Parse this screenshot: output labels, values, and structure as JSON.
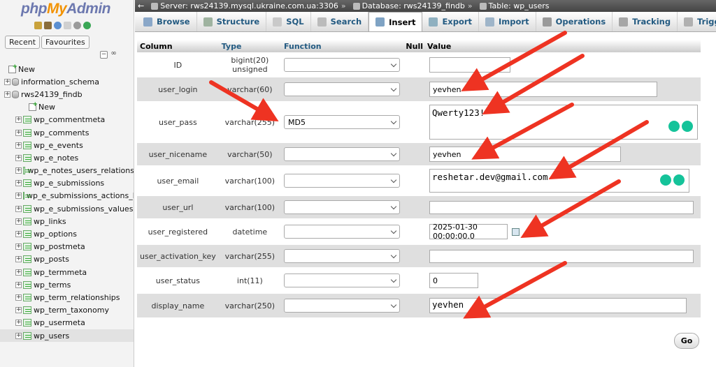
{
  "app": {
    "logo_php": "php",
    "logo_my": "My",
    "logo_admin": "Admin"
  },
  "nav": {
    "recent_label": "Recent",
    "favourites_label": "Favourites",
    "items": [
      {
        "label": "New",
        "kind": "new",
        "indent": 12
      },
      {
        "label": "information_schema",
        "kind": "db",
        "indent": 6
      },
      {
        "label": "rws24139_findb",
        "kind": "db",
        "indent": 6
      },
      {
        "label": "New",
        "kind": "new",
        "indent": 30
      },
      {
        "label": "wp_commentmeta",
        "kind": "table",
        "indent": 22
      },
      {
        "label": "wp_comments",
        "kind": "table",
        "indent": 22
      },
      {
        "label": "wp_e_events",
        "kind": "table",
        "indent": 22
      },
      {
        "label": "wp_e_notes",
        "kind": "table",
        "indent": 22
      },
      {
        "label": "wp_e_notes_users_relations",
        "kind": "table",
        "indent": 22
      },
      {
        "label": "wp_e_submissions",
        "kind": "table",
        "indent": 22
      },
      {
        "label": "wp_e_submissions_actions_lo",
        "kind": "table",
        "indent": 22
      },
      {
        "label": "wp_e_submissions_values",
        "kind": "table",
        "indent": 22
      },
      {
        "label": "wp_links",
        "kind": "table",
        "indent": 22
      },
      {
        "label": "wp_options",
        "kind": "table",
        "indent": 22
      },
      {
        "label": "wp_postmeta",
        "kind": "table",
        "indent": 22
      },
      {
        "label": "wp_posts",
        "kind": "table",
        "indent": 22
      },
      {
        "label": "wp_termmeta",
        "kind": "table",
        "indent": 22
      },
      {
        "label": "wp_terms",
        "kind": "table",
        "indent": 22
      },
      {
        "label": "wp_term_relationships",
        "kind": "table",
        "indent": 22
      },
      {
        "label": "wp_term_taxonomy",
        "kind": "table",
        "indent": 22
      },
      {
        "label": "wp_usermeta",
        "kind": "table",
        "indent": 22
      },
      {
        "label": "wp_users",
        "kind": "table",
        "indent": 22,
        "selected": true
      }
    ]
  },
  "breadcrumb": {
    "server": "Server: rws24139.mysql.ukraine.com.ua:3306",
    "database": "Database: rws24139_findb",
    "table": "Table: wp_users",
    "separator": "»"
  },
  "tabs": [
    {
      "label": "Browse",
      "icon_color": "#8aa7c8"
    },
    {
      "label": "Structure",
      "icon_color": "#9fb3a0"
    },
    {
      "label": "SQL",
      "icon_color": "#c9c9c9"
    },
    {
      "label": "Search",
      "icon_color": "#bbbbbb"
    },
    {
      "label": "Insert",
      "icon_color": "#7fa3c4",
      "active": true
    },
    {
      "label": "Export",
      "icon_color": "#8fb0c0"
    },
    {
      "label": "Import",
      "icon_color": "#9fb5c9"
    },
    {
      "label": "Operations",
      "icon_color": "#9a9a9a"
    },
    {
      "label": "Tracking",
      "icon_color": "#a6a6a6"
    },
    {
      "label": "Triggers",
      "icon_color": "#b0b0b0"
    }
  ],
  "grid": {
    "headers": {
      "column": "Column",
      "type": "Type",
      "function": "Function",
      "null": "Null",
      "value": "Value"
    },
    "rows": [
      {
        "column": "ID",
        "type": "bigint(20) unsigned",
        "function": "",
        "value": "",
        "kind": "input",
        "vw": 116
      },
      {
        "column": "user_login",
        "type": "varchar(60)",
        "function": "",
        "value": "yevhen",
        "kind": "input",
        "vw": 326
      },
      {
        "column": "user_pass",
        "type": "varchar(255)",
        "function": "MD5",
        "value": "Qwerty123!",
        "kind": "textarea",
        "vw": 384
      },
      {
        "column": "user_nicename",
        "type": "varchar(50)",
        "function": "",
        "value": "yevhen",
        "kind": "input",
        "vw": 274
      },
      {
        "column": "user_email",
        "type": "varchar(100)",
        "function": "",
        "value": "reshetar.dev@gmail.com",
        "kind": "textarea",
        "vw": 372
      },
      {
        "column": "user_url",
        "type": "varchar(100)",
        "function": "",
        "value": "",
        "kind": "textarea-thin",
        "vw": 378
      },
      {
        "column": "user_registered",
        "type": "datetime",
        "function": "",
        "value": "2025-01-30 00:00:00.0",
        "kind": "date",
        "vw": 112
      },
      {
        "column": "user_activation_key",
        "type": "varchar(255)",
        "function": "",
        "value": "",
        "kind": "textarea-thin",
        "vw": 378
      },
      {
        "column": "user_status",
        "type": "int(11)",
        "function": "",
        "value": "0",
        "kind": "input",
        "vw": 70
      },
      {
        "column": "display_name",
        "type": "varchar(250)",
        "function": "",
        "value": "yevhen",
        "kind": "textarea-mono",
        "vw": 368
      }
    ]
  },
  "go_label": "Go",
  "colors": {
    "arrow": "#ee3322",
    "tab_link": "#235a81",
    "grammarly": "#15c39a"
  }
}
